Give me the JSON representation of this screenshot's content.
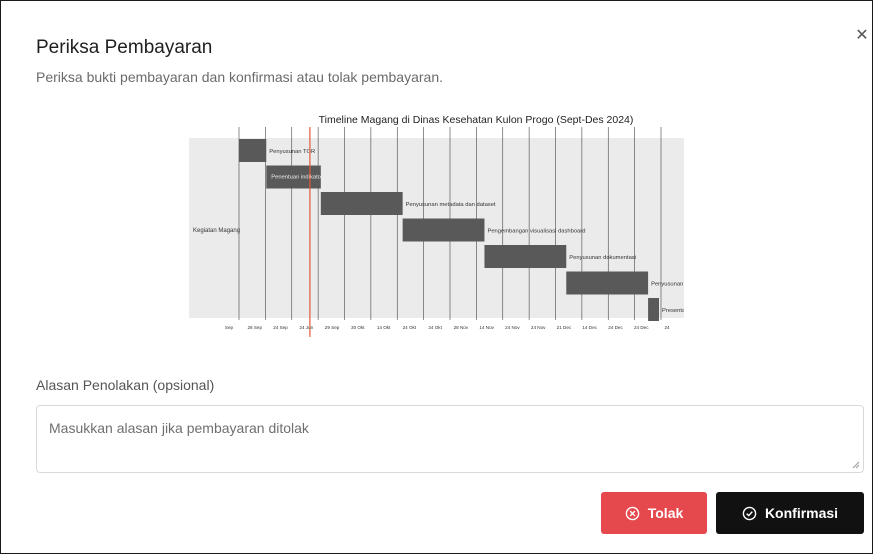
{
  "dialog": {
    "title": "Periksa Pembayaran",
    "subtitle": "Periksa bukti pembayaran dan konfirmasi atau tolak pembayaran.",
    "close_icon": "close-icon",
    "reason_label": "Alasan Penolakan (opsional)",
    "reason_placeholder": "Masukkan alasan jika pembayaran ditolak",
    "reason_value": "",
    "reject_label": "Tolak",
    "reject_icon": "x-circle-icon",
    "confirm_label": "Konfirmasi",
    "confirm_icon": "check-circle-icon",
    "colors": {
      "reject": "#e5484d",
      "confirm": "#111111"
    }
  },
  "chart_data": {
    "type": "gantt",
    "title": "Timeline Magang di Dinas Kesehatan Kulon Progo (Sept-Des 2024)",
    "ylabel": "Kegiatan Magang",
    "x_ticks": [
      "Sep",
      "28 Sep",
      "24 Sep",
      "24 Jun",
      "29 Sep",
      "30 Okt",
      "14 Okt",
      "24 Okt",
      "24 Okt",
      "28 Nov",
      "14 Nov",
      "24 Nov",
      "24 Nov",
      "21 Dec",
      "14 Dec",
      "24 Dec",
      "24 Dec",
      "24"
    ],
    "tasks": [
      {
        "label": "Penyusunan TOR",
        "start": 0,
        "end": 1
      },
      {
        "label": "Penentuan indikator",
        "start": 1,
        "end": 3
      },
      {
        "label": "Penyusunan metadata dan dataset",
        "start": 3,
        "end": 6
      },
      {
        "label": "Pengembangan visualisasi dashboard",
        "start": 6,
        "end": 9
      },
      {
        "label": "Penyusunan dokumentasi",
        "start": 9,
        "end": 12
      },
      {
        "label": "Penyusunan laporan akhir",
        "start": 12,
        "end": 15
      },
      {
        "label": "Presentasi hasil magang",
        "start": 15,
        "end": 15.4
      }
    ],
    "today_marker": 2.6,
    "colors": {
      "bar": "#595959",
      "marker": "#e05a3a",
      "grid": "#444444",
      "background": "#ebebeb"
    }
  }
}
